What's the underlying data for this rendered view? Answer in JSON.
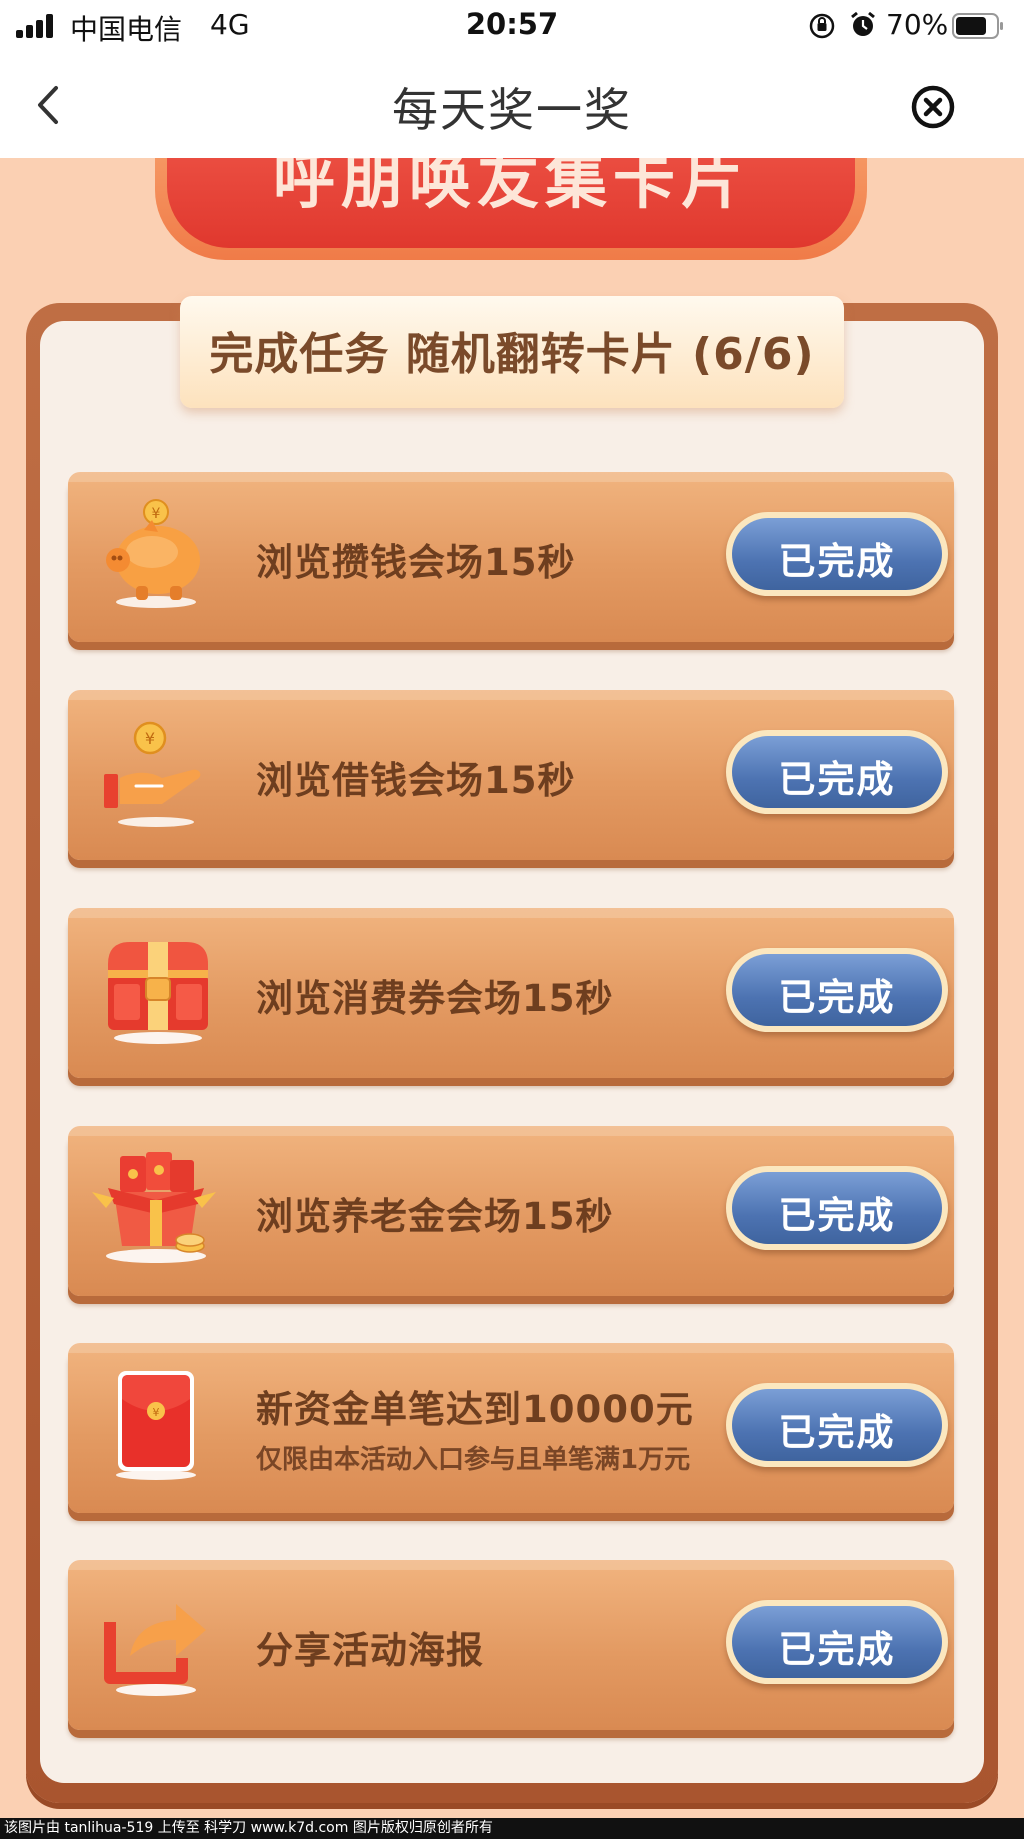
{
  "status_bar": {
    "carrier": "中国电信",
    "network": "4G",
    "time": "20:57",
    "battery": "70%"
  },
  "nav": {
    "title": "每天奖一奖"
  },
  "banner": {
    "text": "呼朋唤友集卡片"
  },
  "panel": {
    "title": "完成任务 随机翻转卡片 (6/6)"
  },
  "tasks": [
    {
      "icon": "piggy-bank-icon",
      "label": "浏览攒钱会场15秒",
      "sub": "",
      "button": "已完成"
    },
    {
      "icon": "hand-coin-icon",
      "label": "浏览借钱会场15秒",
      "sub": "",
      "button": "已完成"
    },
    {
      "icon": "treasure-chest-icon",
      "label": "浏览消费券会场15秒",
      "sub": "",
      "button": "已完成"
    },
    {
      "icon": "gift-box-icon",
      "label": "浏览养老金会场15秒",
      "sub": "",
      "button": "已完成"
    },
    {
      "icon": "red-envelope-icon",
      "label": "新资金单笔达到10000元",
      "sub": "仅限由本活动入口参与且单笔满1万元",
      "button": "已完成"
    },
    {
      "icon": "share-icon",
      "label": "分享活动海报",
      "sub": "",
      "button": "已完成"
    }
  ],
  "footer": {
    "text": "该图片由 tanlihua-519 上传至 科学刀 www.k7d.com 图片版权归原创者所有"
  },
  "colors": {
    "page_bg": "#fbd0b3",
    "panel_frame": "#b5613a",
    "button_blue": "#4d73b2",
    "label_brown": "#6e3e1f"
  }
}
